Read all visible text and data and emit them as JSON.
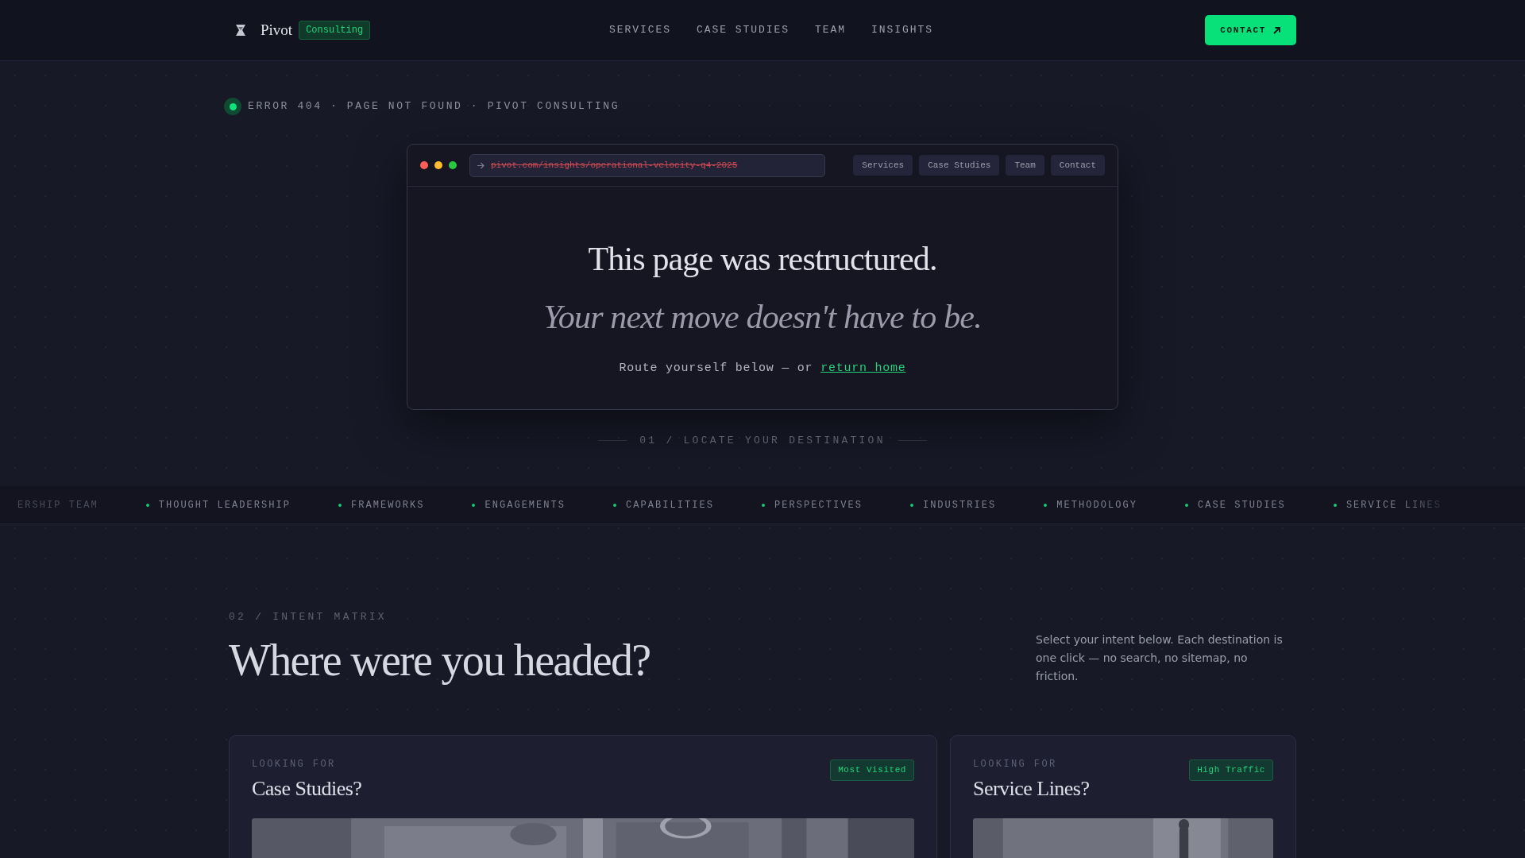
{
  "header": {
    "brand": "Pivot",
    "brand_tag": "Consulting",
    "nav": [
      "SERVICES",
      "CASE STUDIES",
      "TEAM",
      "INSIGHTS"
    ],
    "cta": "CONTACT"
  },
  "status_line": "ERROR 404 · PAGE NOT FOUND · PIVOT CONSULTING",
  "browser": {
    "url": "pivot.com/insights/operational-velocity-q4-2025",
    "tabs": [
      "Services",
      "Case Studies",
      "Team",
      "Contact"
    ],
    "headline": "This page was restructured.",
    "subheadline": "Your next move doesn't have to be.",
    "route_text": "Route yourself below — or",
    "route_link": "return home"
  },
  "section_label": "01 / LOCATE YOUR DESTINATION",
  "ticker": [
    {
      "label": "ERSHIP TEAM",
      "kind": "partial"
    },
    {
      "label": "THOUGHT LEADERSHIP",
      "kind": "full"
    },
    {
      "label": "FRAMEWORKS",
      "kind": "full"
    },
    {
      "label": "ENGAGEMENTS",
      "kind": "full"
    },
    {
      "label": "CAPABILITIES",
      "kind": "full"
    },
    {
      "label": "PERSPECTIVES",
      "kind": "full"
    },
    {
      "label": "INDUSTRIES",
      "kind": "full"
    },
    {
      "label": "METHODOLOGY",
      "kind": "full"
    },
    {
      "label": "CASE STUDIES",
      "kind": "full"
    },
    {
      "label": "SERVICE LINES",
      "kind": "fading"
    }
  ],
  "intent": {
    "label": "02 / INTENT MATRIX",
    "title": "Where were you headed?",
    "description": "Select your intent below. Each destination is one click — no search, no sitemap, no friction.",
    "cards": [
      {
        "eyebrow": "LOOKING FOR",
        "title": "Case Studies?",
        "badge": "Most Visited"
      },
      {
        "eyebrow": "LOOKING FOR",
        "title": "Service Lines?",
        "badge": "High Traffic"
      }
    ]
  }
}
